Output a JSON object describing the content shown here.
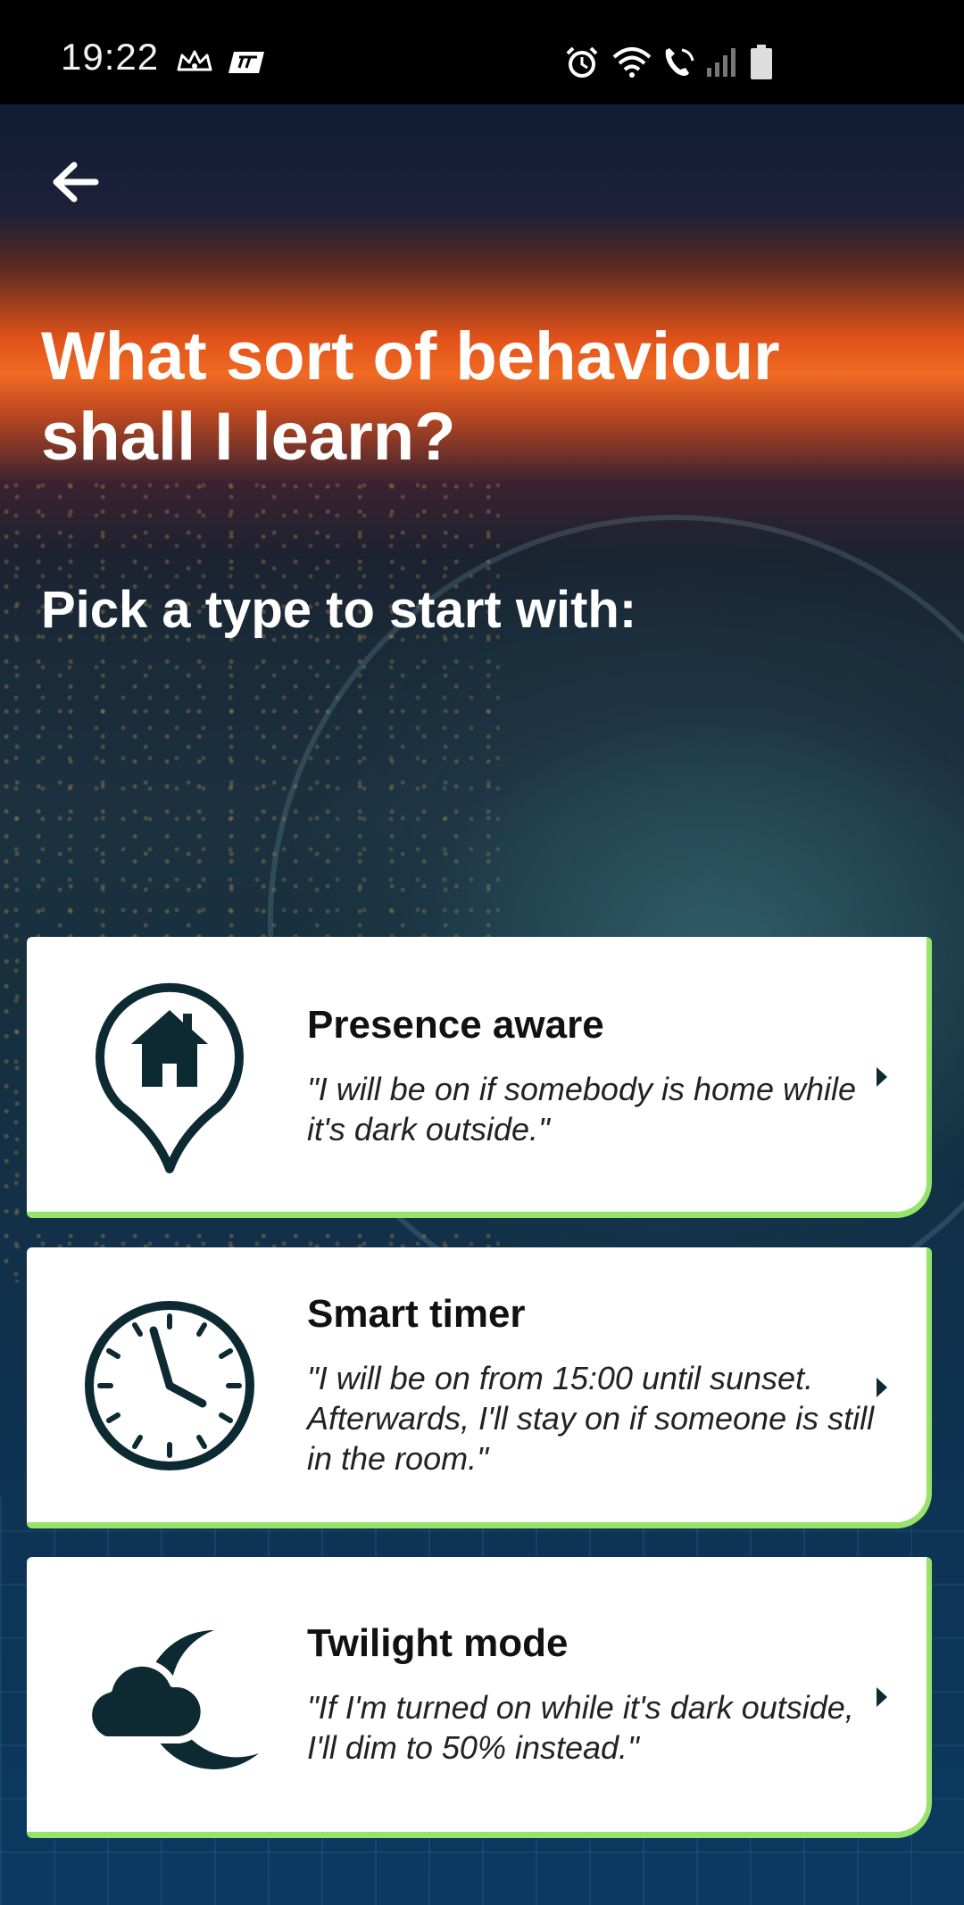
{
  "status_bar": {
    "time": "19:22",
    "icons": [
      "crown-icon",
      "app-badge-icon",
      "alarm-icon",
      "wifi-icon",
      "call-icon",
      "signal-icon",
      "battery-icon"
    ]
  },
  "header": {
    "back_icon": "arrow-left-icon",
    "title": "What sort of behaviour shall I learn?",
    "subtitle": "Pick a type to start with:"
  },
  "options": [
    {
      "icon": "home-location-icon",
      "title": "Presence aware",
      "description": "\"I will be on if somebody is home while it's dark outside.\""
    },
    {
      "icon": "clock-icon",
      "title": "Smart timer",
      "description": "\"I will be on from 15:00 until sunset. Afterwards, I'll stay on if someone is still in the room.\""
    },
    {
      "icon": "cloud-moon-icon",
      "title": "Twilight mode",
      "description": "\"If I'm turned on while it's dark outside, I'll dim to 50% instead.\""
    }
  ],
  "colors": {
    "accent": "#95e36a",
    "icon_dark": "#0d2a33",
    "card_bg": "#ffffff"
  }
}
